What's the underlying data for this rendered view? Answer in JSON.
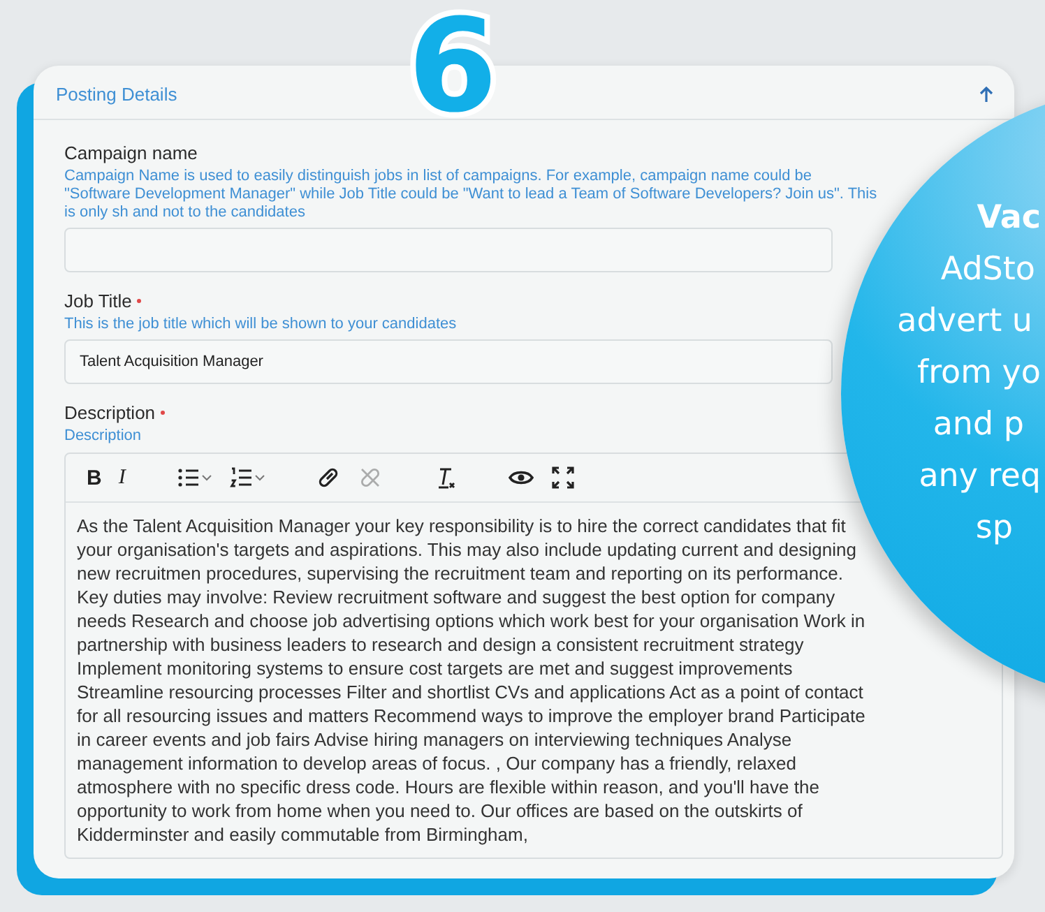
{
  "step_number": "6",
  "section": {
    "title": "Posting Details",
    "expanded": true
  },
  "fields": [
    {
      "kind": "text",
      "label": "Campaign name",
      "required": false,
      "help": "Campaign Name is used to easily distinguish jobs in list of campaigns. For example, campaign name could be \"Software Development Manager\" while Job Title could be \"Want to lead a Team of Software Developers? Join us\". This is only sh and not to the candidates"
    },
    {
      "kind": "text",
      "label": "Job Title",
      "required": true,
      "help": "This is the job title which will be shown to your candidates",
      "value": "Talent Acquisition Manager"
    },
    {
      "kind": "editor",
      "label": "Description",
      "required": true,
      "help": "Description",
      "toolbar": [
        {
          "kind": "bold",
          "label": "B",
          "disabled": false
        },
        {
          "kind": "italic",
          "label": "I",
          "disabled": false
        },
        {
          "kind": "bullet-list",
          "disabled": false
        },
        {
          "kind": "numbered-list",
          "disabled": false
        },
        {
          "kind": "link",
          "disabled": false
        },
        {
          "kind": "unlink",
          "disabled": true
        },
        {
          "kind": "clear-format",
          "disabled": false
        },
        {
          "kind": "preview",
          "disabled": false
        },
        {
          "kind": "fullscreen",
          "disabled": false
        }
      ],
      "value": "As the Talent Acquisition Manager your key responsibility is to hire the correct candidates that fit your organisation's targets and aspirations. This may also include updating current and designing new recruitmen procedures, supervising the recruitment team and reporting on its performance. Key duties may involve: Review recruitment software and suggest the best option for company needs Research and choose job advertising options which work best for your organisation Work in partnership with business leaders to research and design a consistent recruitment strategy Implement monitoring systems to ensure cost targets are met and suggest improvements Streamline resourcing processes Filter and shortlist CVs and applications Act as a point of contact for all resourcing issues and matters Recommend ways to improve the employer brand Participate in career events and job fairs Advise hiring managers on interviewing techniques Analyse management information to develop areas of focus. , Our company has a friendly, relaxed atmosphere with no specific dress code. Hours are flexible within reason, and you'll have the opportunity to work from home when you need to. Our offices are based on the outskirts of Kidderminster and easily commutable from Birmingham,"
    }
  ],
  "promo": {
    "heading": "Vac",
    "lines": [
      "AdSto",
      "advert u",
      "from yo",
      "and p",
      "any req",
      "sp"
    ]
  }
}
